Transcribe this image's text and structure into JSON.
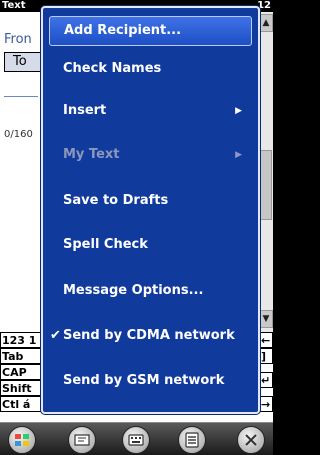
{
  "status_bar": {
    "title": "Text",
    "clock": "12"
  },
  "compose": {
    "from_label": "Fron",
    "to_label": "To",
    "char_counter": "0/160"
  },
  "menu": {
    "items": [
      {
        "label": "Add Recipient...",
        "state": "selected"
      },
      {
        "label": "Check Names",
        "state": "enabled"
      },
      {
        "label": "Insert",
        "state": "enabled",
        "submenu": true
      },
      {
        "label": "My Text",
        "state": "disabled",
        "submenu": true
      },
      {
        "label": "Save to Drafts",
        "state": "enabled"
      },
      {
        "label": "Spell Check",
        "state": "enabled"
      },
      {
        "label": "Message Options...",
        "state": "enabled"
      },
      {
        "label": "Send by CDMA network",
        "state": "checked"
      },
      {
        "label": "Send by GSM network",
        "state": "enabled"
      }
    ],
    "arrow_glyph": "▶",
    "check_glyph": "✔"
  },
  "keyboard": {
    "row1": "123 1",
    "row2": "Tab",
    "row3": "CAP",
    "row4": "Shift",
    "row5": "Ctl á",
    "right_keys": [
      "←",
      "]",
      "↵",
      "→"
    ]
  },
  "scrollbar": {
    "up": "▲",
    "down": "▼"
  },
  "taskbar": {
    "icons": [
      "windows-start-icon",
      "message-icon",
      "keyboard-icon",
      "menu-icon",
      "close-icon"
    ]
  },
  "colors": {
    "menu_bg": "#103b9c",
    "menu_selected": "#2b5fd9",
    "menu_disabled_text": "#8b97bd",
    "label_text": "#3a5a9a"
  }
}
